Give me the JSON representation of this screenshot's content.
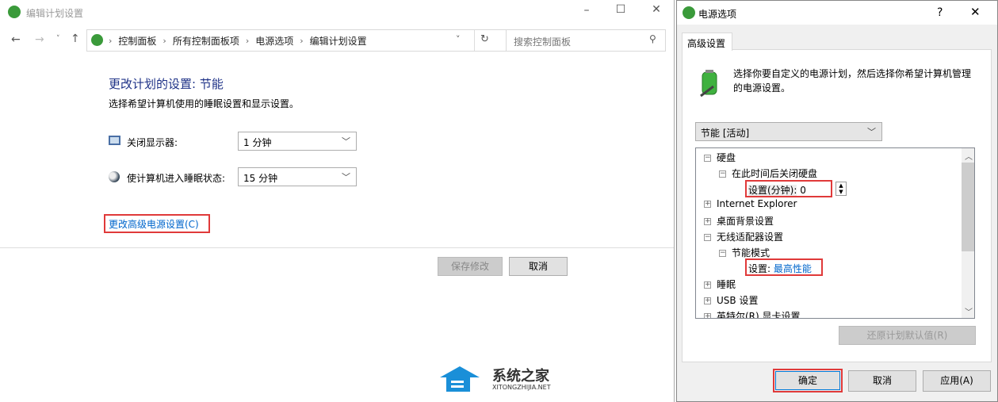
{
  "left_window": {
    "title": "编辑计划设置",
    "breadcrumb": [
      "控制面板",
      "所有控制面板项",
      "电源选项",
      "编辑计划设置"
    ],
    "search_placeholder": "搜索控制面板",
    "heading": "更改计划的设置: 节能",
    "subtitle": "选择希望计算机使用的睡眠设置和显示设置。",
    "settings": [
      {
        "label": "关闭显示器:",
        "value": "1 分钟",
        "icon": "monitor-icon"
      },
      {
        "label": "使计算机进入睡眠状态:",
        "value": "15 分钟",
        "icon": "moon-icon"
      }
    ],
    "advanced_link": "更改高级电源设置(C)",
    "save_label": "保存修改",
    "cancel_label": "取消"
  },
  "dialog": {
    "title": "电源选项",
    "help": "?",
    "tab": "高级设置",
    "description": "选择你要自定义的电源计划，然后选择你希望计算机管理的电源设置。",
    "plan": "节能 [活动]",
    "tree": {
      "hdd": "硬盘",
      "hdd_off": "在此时间后关闭硬盘",
      "hdd_setting_label": "设置(分钟):",
      "hdd_setting_value": "0",
      "ie": "Internet Explorer",
      "desktop": "桌面背景设置",
      "wireless": "无线适配器设置",
      "power_mode": "节能模式",
      "power_mode_label": "设置:",
      "power_mode_value": "最高性能",
      "sleep": "睡眠",
      "usb": "USB 设置",
      "intel": "英特尔(R) 显卡设置"
    },
    "restore_label": "还原计划默认值(R)",
    "ok_label": "确定",
    "cancel_label": "取消",
    "apply_label": "应用(A)"
  },
  "watermark": {
    "name": "系统之家",
    "url": "XITONGZHIJIA.NET"
  },
  "colors": {
    "link": "#0066cc",
    "heading": "#1e3287",
    "highlight": "#e03a3a"
  }
}
